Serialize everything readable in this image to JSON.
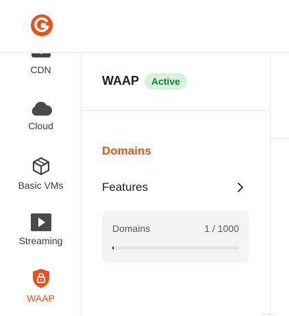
{
  "colors": {
    "accent": "#e8511c",
    "active_badge_bg": "#d6f3de",
    "active_badge_text": "#1a7a3a"
  },
  "logo": {
    "icon": "gcore-logo-icon"
  },
  "sidebar": {
    "items": [
      {
        "label": "CDN",
        "icon": "cdn-icon"
      },
      {
        "label": "Cloud",
        "icon": "cloud-icon"
      },
      {
        "label": "Basic VMs",
        "icon": "cube-icon"
      },
      {
        "label": "Streaming",
        "icon": "play-icon"
      },
      {
        "label": "WAAP",
        "icon": "shield-lock-icon",
        "active": true
      }
    ]
  },
  "panel": {
    "title": "WAAP",
    "status": "Active",
    "nav": [
      {
        "label": "Domains",
        "active": true
      },
      {
        "label": "Features",
        "icon": "chevron-right-icon"
      }
    ],
    "quota": {
      "label": "Domains",
      "count": "1 / 1000",
      "fraction": 0.001
    }
  }
}
